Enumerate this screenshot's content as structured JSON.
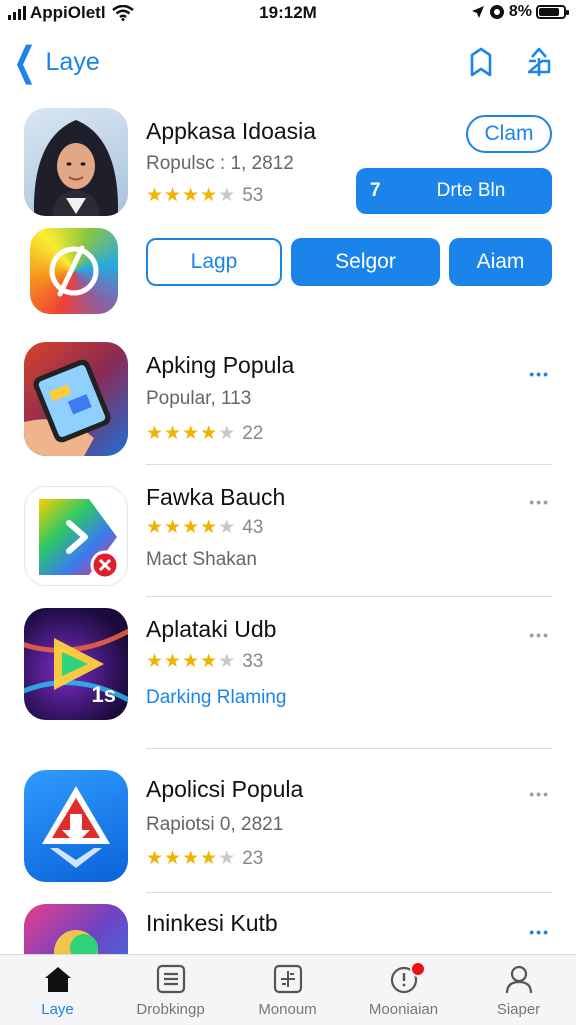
{
  "status": {
    "carrier": "AppiOletl",
    "time": "19:12M",
    "battery_text": "8%",
    "battery_level": 0.9
  },
  "nav": {
    "back_label": "Laye"
  },
  "apps": [
    {
      "name": "Appkasa Idoasia",
      "subtitle": "Ropulsc : 1, 2812",
      "rating": 4,
      "count": "53",
      "buttons": {
        "get": "Clam",
        "action": "Drte Bln",
        "action_icon": "7"
      }
    },
    {
      "name": "",
      "buttons": {
        "outline": "Lagp",
        "mid": "Selgor",
        "right": "Aiam"
      }
    },
    {
      "name": "Apking Popula",
      "subtitle": "Popular, 113",
      "rating": 4,
      "count": "22",
      "more": "•••",
      "more_color": "#1a84ea"
    },
    {
      "name": "Fawka Bauch",
      "subtitle": "Mact Shakan",
      "rating": 4,
      "count": "43",
      "more": "•••",
      "more_color": "#a0a0a0"
    },
    {
      "name": "Aplataki Udb",
      "subtitle": "Darking Rlaming",
      "rating": 4,
      "count": "33",
      "more": "•••",
      "more_color": "#a0a0a0",
      "icon_label": "1s"
    },
    {
      "name": "Apolicsi Popula",
      "subtitle": "Rapiotsi 0, 2821",
      "rating": 4,
      "count": "23",
      "more": "•••",
      "more_color": "#a0a0a0"
    },
    {
      "name": "Ininkesi Kutb",
      "more": "•••",
      "more_color": "#1a84ea"
    }
  ],
  "tabs": [
    {
      "label": "Laye",
      "icon": "home-icon",
      "active": true
    },
    {
      "label": "Drobkingp",
      "icon": "list-icon"
    },
    {
      "label": "Monoum",
      "icon": "calculator-icon"
    },
    {
      "label": "Mooniaian",
      "icon": "clock-icon",
      "badge": true
    },
    {
      "label": "Siaper",
      "icon": "person-icon"
    }
  ],
  "colors": {
    "accent": "#1a84ea",
    "star": "#f0b400",
    "badge": "#ee1111"
  }
}
